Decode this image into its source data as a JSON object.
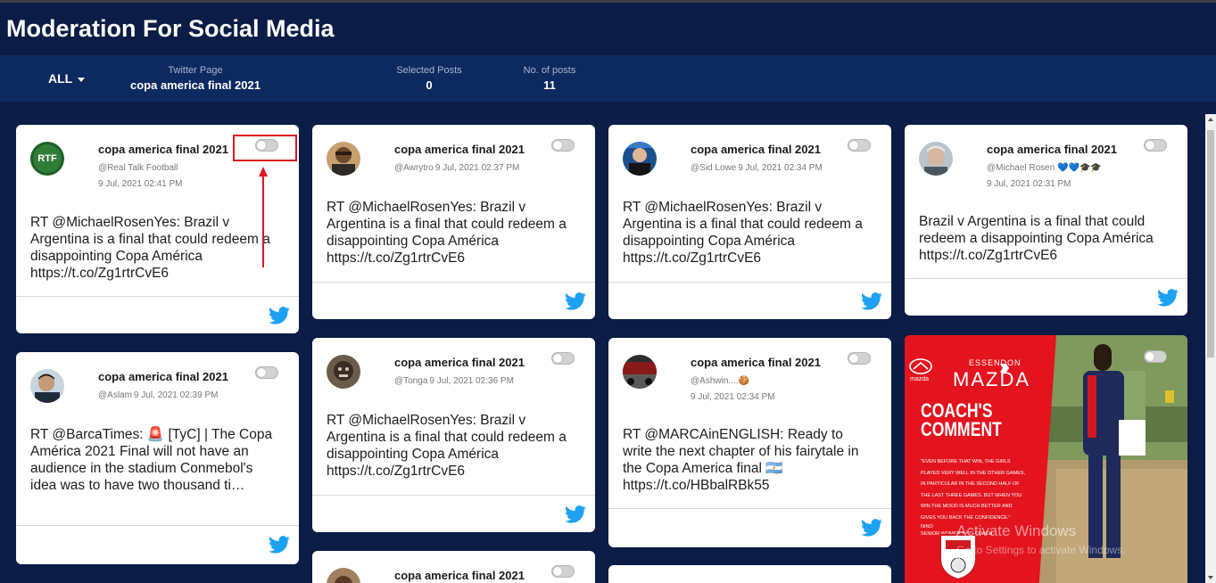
{
  "app": {
    "title": "Moderation For Social Media"
  },
  "filter": {
    "label": "ALL"
  },
  "stats": {
    "twitter_page": {
      "label": "Twitter Page",
      "value": "copa america final 2021"
    },
    "selected_posts": {
      "label": "Selected Posts",
      "value": "0"
    },
    "num_posts": {
      "label": "No. of posts",
      "value": "11"
    }
  },
  "colors": {
    "background": "#0b1c46",
    "subbar": "#0d2a60",
    "twitter": "#1da1f2",
    "highlight": "#e0141e"
  },
  "posts": [
    {
      "title": "copa america final 2021",
      "handle": "@Real Talk Football",
      "date": "9 Jul, 2021 02:41 PM",
      "text": "RT @MichaelRosenYes: Brazil v Argentina is a final that could redeem a disappointing Copa América https://t.co/Zg1rtrCvE6"
    },
    {
      "title": "copa america final 2021",
      "handle": "@Awrytro",
      "date": "9 Jul, 2021 02:37 PM",
      "text": "RT @MichaelRosenYes: Brazil v Argentina is a final that could redeem a disappointing Copa América https://t.co/Zg1rtrCvE6"
    },
    {
      "title": "copa america final 2021",
      "handle": "@Sid Lowe",
      "date": "9 Jul, 2021 02:34 PM",
      "text": "RT @MichaelRosenYes: Brazil v Argentina is a final that could redeem a disappointing Copa América https://t.co/Zg1rtrCvE6"
    },
    {
      "title": "copa america final 2021",
      "handle": "@Michael Rosen 💙💙🎓🎓",
      "date": "9 Jul, 2021 02:31 PM",
      "text": "Brazil v Argentina is a final that could redeem a disappointing Copa América https://t.co/Zg1rtrCvE6"
    },
    {
      "title": "copa america final 2021",
      "handle": "@Aslam",
      "date": "9 Jul, 2021 02:39 PM",
      "text": "RT @BarcaTimes: 🚨 [TyC] | The Copa América 2021 Final will not have an audience in the stadium Conmebol's idea was to have two thousand ti…"
    },
    {
      "title": "copa america final 2021",
      "handle": "@Tonga",
      "date": "9 Jul, 2021 02:36 PM",
      "text": "RT @MichaelRosenYes: Brazil v Argentina is a final that could redeem a disappointing Copa América https://t.co/Zg1rtrCvE6"
    },
    {
      "title": "copa america final 2021",
      "handle": "@Ashwin....🍪",
      "date": "9 Jul, 2021 02:34 PM",
      "text": "RT @MARCAinENGLISH: Ready to write the next chapter of his fairytale in the Copa America final 🇦🇷 https://t.co/HBbalRBk55"
    },
    {
      "title": "copa america final 2021"
    }
  ],
  "media": {
    "brand_small": "ESSENDON",
    "brand_big": "MAZDA",
    "brand_mark": "mazda",
    "headline_1": "COACH'S",
    "headline_2": "COMMENT",
    "quote_lines": [
      "\"EVEN BEFORE THAT WIN, THE GIRLS",
      "PLAYED VERY WELL IN THE OTHER GAMES,",
      "IN PARTICULAR IN THE SECOND HALF OF",
      "THE LAST THREE GAMES. BUT WHEN YOU",
      "WIN THE MOOD IS MUCH BETTER AND",
      "GIVES YOU BACK THE CONFIDENCE.\""
    ],
    "quote_author": "NINO",
    "quote_role": "SENIOR WOMEN'S CO-COACH",
    "badge_text": "ROYALS"
  },
  "watermark": {
    "line1": "Activate Windows",
    "line2": "Go to Settings to activate Windows."
  }
}
